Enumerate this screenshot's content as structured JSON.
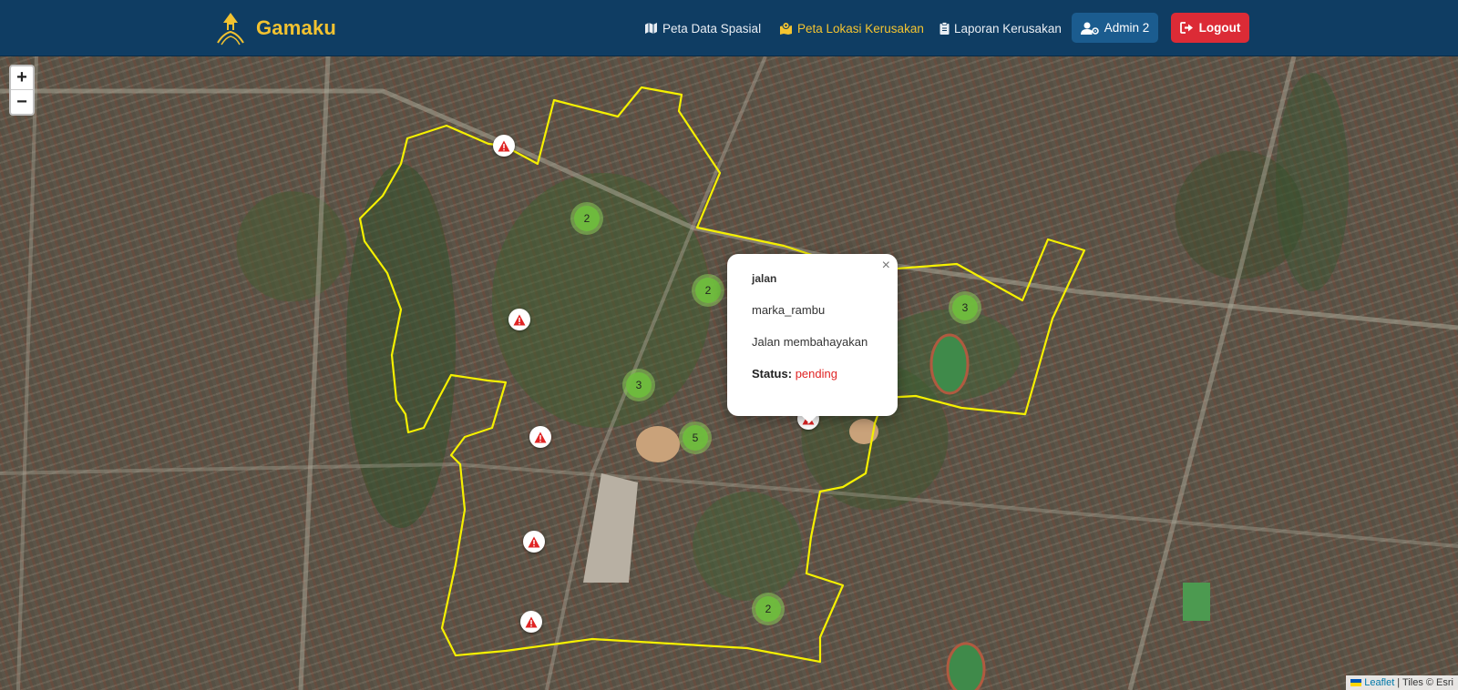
{
  "brand": {
    "name": "Gamaku"
  },
  "nav": {
    "items": [
      {
        "label": "Peta Data Spasial",
        "icon": "map-icon",
        "active": false
      },
      {
        "label": "Peta Lokasi Kerusakan",
        "icon": "map-location-icon",
        "active": true
      },
      {
        "label": "Laporan Kerusakan",
        "icon": "clipboard-icon",
        "active": false
      }
    ],
    "admin_label": "Admin 2",
    "logout_label": "Logout"
  },
  "map": {
    "zoom_in": "+",
    "zoom_out": "−",
    "clusters": [
      {
        "count": "2"
      },
      {
        "count": "2"
      },
      {
        "count": "3"
      },
      {
        "count": "3"
      },
      {
        "count": "5"
      },
      {
        "count": "2"
      }
    ],
    "popup": {
      "title": "jalan",
      "category": "marka_rambu",
      "description": "Jalan membahayakan",
      "status_label": "Status:",
      "status_value": "pending",
      "close": "×"
    },
    "attribution": {
      "leaflet": "Leaflet",
      "tiles": "| Tiles © Esri"
    }
  },
  "colors": {
    "navbar": "#0f3d63",
    "brand": "#f2c230",
    "active_nav": "#f4c430",
    "logout": "#dc2b36",
    "boundary": "#f5f000",
    "cluster": "#7cc04a",
    "status_pending": "#e02424"
  }
}
